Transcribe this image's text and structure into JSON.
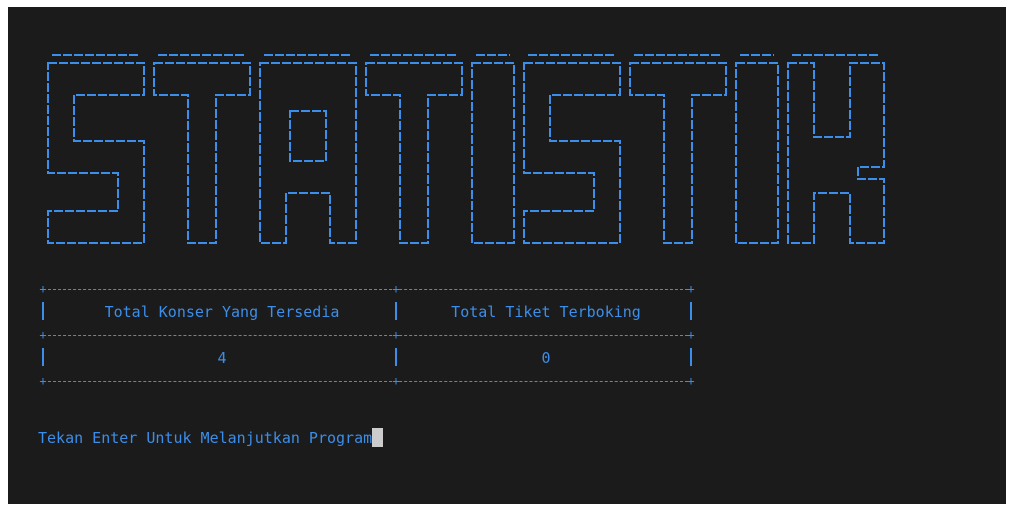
{
  "terminal": {
    "banner_text": "STATISTIK",
    "table": {
      "headers": [
        "Total Konser Yang Tersedia",
        "Total Tiket Terboking"
      ],
      "values": [
        "4",
        "0"
      ]
    },
    "prompt": "Tekan Enter Untuk Melanjutkan Program"
  },
  "colors": {
    "background": "#1b1b1b",
    "text": "#3b8eea",
    "cursor": "#cccccc"
  }
}
